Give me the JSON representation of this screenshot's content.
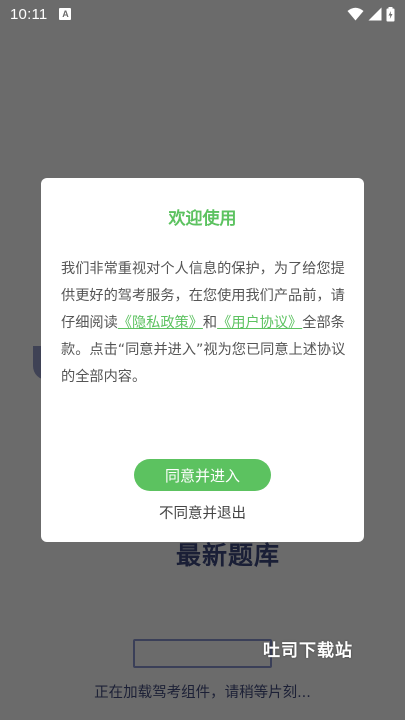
{
  "status_bar": {
    "time": "10:11",
    "notification_icon": "a-icon",
    "icons": [
      "wifi-icon",
      "signal-icon",
      "battery-charging-icon"
    ]
  },
  "background": {
    "heading": "最新题库",
    "loading_text": "正在加载驾考组件，请稍等片刻...",
    "watermark": "吐司下载站"
  },
  "dialog": {
    "title": "欢迎使用",
    "body_part1": "我们非常重视对个人信息的保护，为了给您提供更好的驾考服务，在您使用我们产品前，请仔细阅读",
    "privacy_link": "《隐私政策》",
    "and_text": "和",
    "user_agreement_link": "《用户协议》",
    "body_part2": "全部条款。点击“同意并进入”视为您已同意上述协议的全部内容。",
    "agree_label": "同意并进入",
    "disagree_label": "不同意并退出"
  },
  "colors": {
    "accent": "#5cc260",
    "overlay": "#6b6b6b",
    "dialog_bg": "#ffffff"
  }
}
